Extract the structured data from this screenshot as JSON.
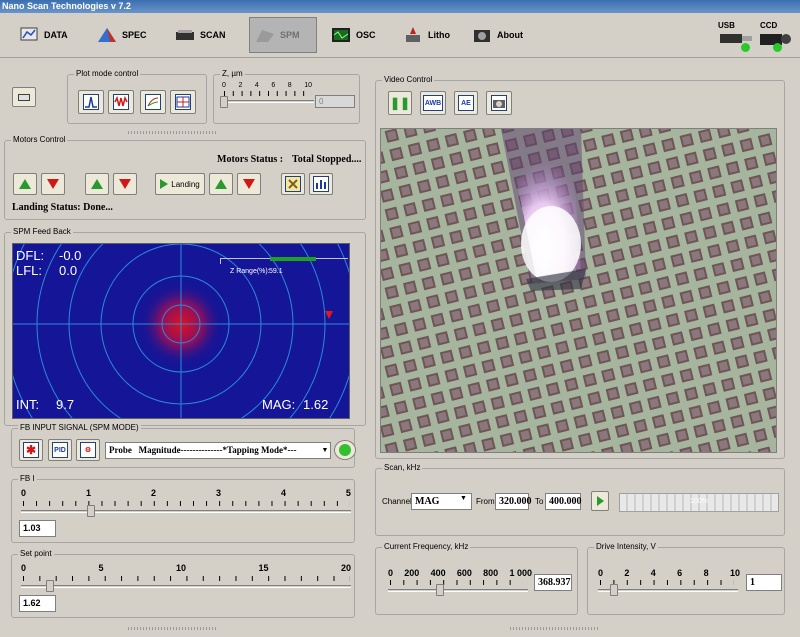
{
  "window": {
    "title": "Nano Scan Technologies v 7.2"
  },
  "toolbar": {
    "items": [
      {
        "label": "DATA",
        "icon": "data-icon"
      },
      {
        "label": "SPEC",
        "icon": "spec-icon"
      },
      {
        "label": "SCAN",
        "icon": "scan-icon"
      },
      {
        "label": "SPM",
        "icon": "spm-icon",
        "active": true
      },
      {
        "label": "OSC",
        "icon": "osc-icon"
      },
      {
        "label": "Litho",
        "icon": "litho-icon"
      },
      {
        "label": "About",
        "icon": "about-icon"
      }
    ],
    "usb_label": "USB",
    "ccd_label": "CCD"
  },
  "plot_mode": {
    "title": "Plot mode control"
  },
  "z_panel": {
    "title": "Z, µm",
    "ticks": [
      "0",
      "2",
      "4",
      "6",
      "8",
      "10"
    ],
    "value": "0"
  },
  "motors": {
    "title": "Motors Control",
    "status_label": "Motors Status :",
    "status_value": "Total Stopped....",
    "landing_button": "Landing",
    "landing_status": "Landing Status: Done..."
  },
  "feedback": {
    "title": "SPM Feed Back",
    "dfl_label": "DFL:",
    "dfl_value": "-0.0",
    "lfl_label": "LFL:",
    "lfl_value": "0.0",
    "int_label": "INT:",
    "int_value": "9.7",
    "mag_label": "MAG:",
    "mag_value": "1.62",
    "zrange_label": "Z Range(%):",
    "zrange_value": "59.1",
    "zrange_fraction": 0.591
  },
  "fb_input": {
    "title": "FB INPUT SIGNAL (SPM MODE)",
    "pid_label": "PID",
    "signal_select": "Probe   Magnitude--------------*Tapping Mode*---"
  },
  "fbi": {
    "title": "FB I",
    "ticks": [
      "0",
      "1",
      "2",
      "3",
      "4",
      "5"
    ],
    "value": "1.03",
    "level": 1.03
  },
  "setpoint": {
    "title": "Set point",
    "ticks": [
      "0",
      "5",
      "10",
      "15",
      "20"
    ],
    "value": "1.62",
    "level": 1.62
  },
  "video": {
    "title": "Video Control",
    "awb_label": "AWB",
    "ae_label": "AE"
  },
  "scan": {
    "title": "Scan, kHz",
    "channel_label": "Channel",
    "channel_value": "MAG",
    "from_label": "From",
    "from_value": "320.000",
    "to_label": "To",
    "to_value": "400.000",
    "progress_text": "100%",
    "progress": 1.0
  },
  "frequency": {
    "title": "Current Frequency, kHz",
    "ticks": [
      "0",
      "200",
      "400",
      "600",
      "800",
      "1 000"
    ],
    "value": "368.937",
    "level": 368.937
  },
  "drive": {
    "title": "Drive Intensity, V",
    "ticks": [
      "0",
      "2",
      "4",
      "6",
      "8",
      "10"
    ],
    "value": "1",
    "level": 1
  },
  "colors": {
    "monitor_bg": "#151597",
    "accent_green": "#2a9a30",
    "accent_red": "#d01818",
    "title_blue": "#3a6fb0"
  }
}
